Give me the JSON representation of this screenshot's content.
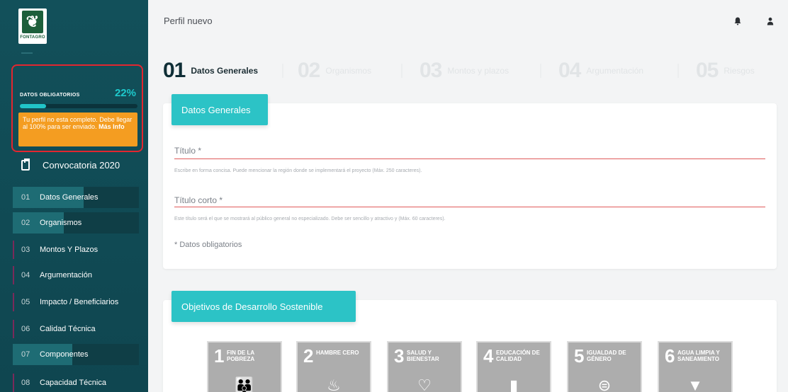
{
  "sidebar": {
    "logo_text": "FONTAGRO",
    "progress": {
      "label": "DATOS OBLIGATORIOS",
      "percent_text": "22%",
      "percent": 0.22,
      "warning_text": "Tu perfil no esta completo. Debe llegar al 100% para ser enviado.",
      "warning_link": "Más Info"
    },
    "convocatoria": "Convocatoria 2020",
    "items": [
      {
        "num": "01",
        "label": "Datos Generales"
      },
      {
        "num": "02",
        "label": "Organismos"
      },
      {
        "num": "03",
        "label": "Montos Y Plazos"
      },
      {
        "num": "04",
        "label": "Argumentación"
      },
      {
        "num": "05",
        "label": "Impacto / Beneficiarios"
      },
      {
        "num": "06",
        "label": "Calidad Técnica"
      },
      {
        "num": "07",
        "label": "Componentes"
      },
      {
        "num": "08",
        "label": "Capacidad Técnica"
      }
    ]
  },
  "header": {
    "title": "Perfil nuevo",
    "icons": [
      "bell-icon",
      "user-icon"
    ]
  },
  "steps": [
    {
      "num": "01",
      "label": "Datos Generales"
    },
    {
      "num": "02",
      "label": "Organismos"
    },
    {
      "num": "03",
      "label": "Montos y plazos"
    },
    {
      "num": "04",
      "label": "Argumentación"
    },
    {
      "num": "05",
      "label": "Riesgos"
    }
  ],
  "form": {
    "section_title": "Datos Generales",
    "titulo_label": "Título *",
    "titulo_help": "Escribe en forma concisa. Puede mencionar la región donde se implementará el proyecto (Máx. 250 caracteres).",
    "titulo_corto_label": "Título corto *",
    "titulo_corto_help": "Este título será el que se mostrará al público general no especializado. Debe ser sencillo y atractivo y (Máx. 60 caracteres).",
    "required_note": "* Datos obligatorios"
  },
  "ods": {
    "section_title": "Objetivos de Desarrollo Sostenible",
    "items": [
      {
        "num": "1",
        "title": "FIN DE LA POBREZA"
      },
      {
        "num": "2",
        "title": "HAMBRE CERO"
      },
      {
        "num": "3",
        "title": "SALUD Y BIENESTAR"
      },
      {
        "num": "4",
        "title": "EDUCACIÓN DE CALIDAD"
      },
      {
        "num": "5",
        "title": "IGUALDAD DE GÉNERO"
      },
      {
        "num": "6",
        "title": "AGUA LIMPIA Y SANEAMIENTO"
      }
    ]
  },
  "colors": {
    "sidebar_bg": "#12505a",
    "accent_teal": "#2cc3c6",
    "warning_orange": "#f49d21",
    "highlight_red": "#e3262f",
    "ods_gray": "#adadad"
  }
}
